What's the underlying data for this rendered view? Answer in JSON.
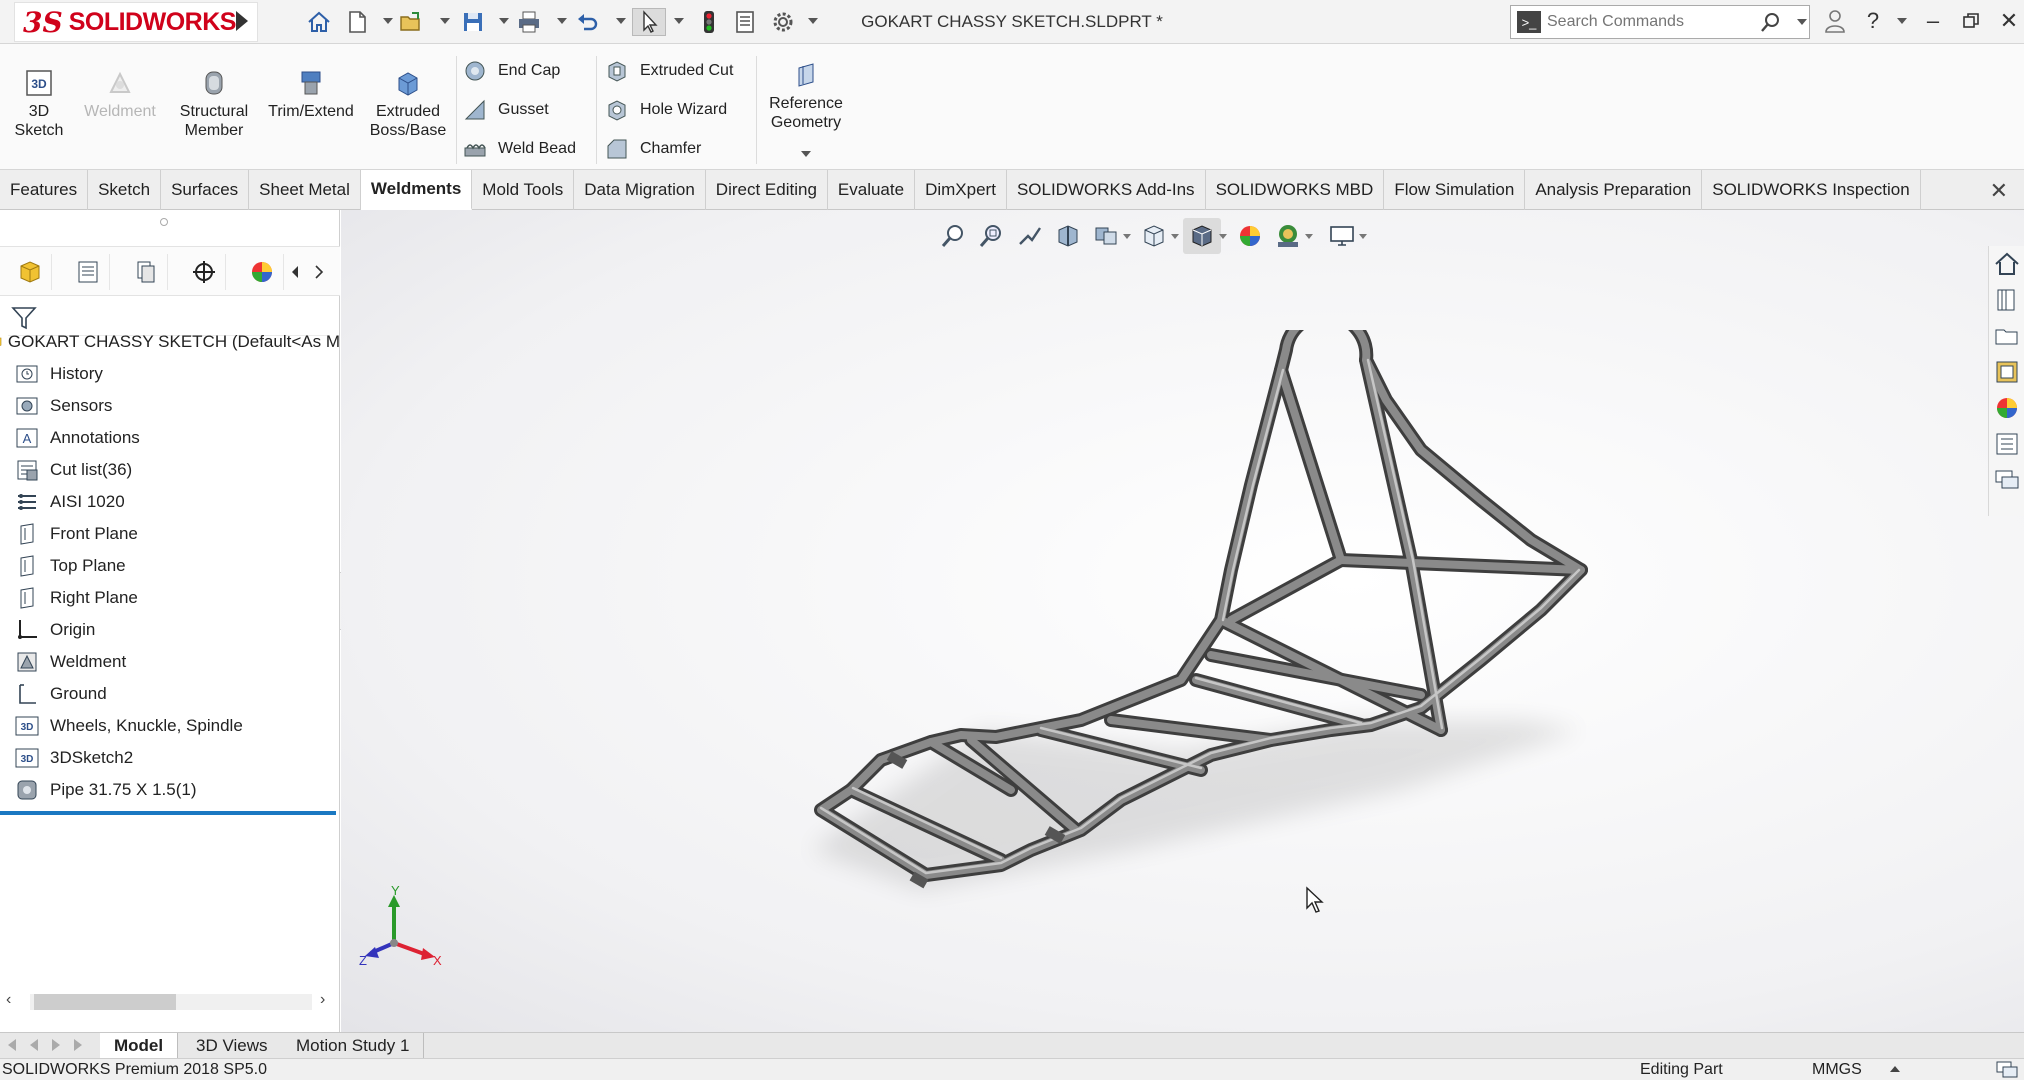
{
  "app": {
    "brand_mark": "3S",
    "brand_name": "SOLIDWORKS",
    "document_title": "GOKART CHASSY SKETCH.SLDPRT *"
  },
  "search": {
    "placeholder": "Search Commands"
  },
  "commands": {
    "sketch3d": "3D\nSketch",
    "weldment": "Weldment",
    "structural_member": "Structural\nMember",
    "trim_extend": "Trim/Extend",
    "extruded_boss": "Extruded\nBoss/Base",
    "end_cap": "End Cap",
    "gusset": "Gusset",
    "weld_bead": "Weld Bead",
    "extruded_cut": "Extruded Cut",
    "hole_wizard": "Hole Wizard",
    "chamfer": "Chamfer",
    "reference_geometry": "Reference\nGeometry"
  },
  "tabs": [
    "Features",
    "Sketch",
    "Surfaces",
    "Sheet Metal",
    "Weldments",
    "Mold Tools",
    "Data Migration",
    "Direct Editing",
    "Evaluate",
    "DimXpert",
    "SOLIDWORKS Add-Ins",
    "SOLIDWORKS MBD",
    "Flow Simulation",
    "Analysis Preparation",
    "SOLIDWORKS Inspection"
  ],
  "active_tab": "Weldments",
  "tree": {
    "root": "GOKART CHASSY SKETCH  (Default<As M",
    "items": [
      {
        "label": "History",
        "icon": "history-icon"
      },
      {
        "label": "Sensors",
        "icon": "sensors-icon"
      },
      {
        "label": "Annotations",
        "icon": "annotations-icon"
      },
      {
        "label": "Cut list(36)",
        "icon": "cut-list-icon"
      },
      {
        "label": "AISI 1020",
        "icon": "material-icon"
      },
      {
        "label": "Front Plane",
        "icon": "plane-icon"
      },
      {
        "label": "Top Plane",
        "icon": "plane-icon"
      },
      {
        "label": "Right Plane",
        "icon": "plane-icon"
      },
      {
        "label": "Origin",
        "icon": "origin-icon"
      },
      {
        "label": "Weldment",
        "icon": "weldment-icon"
      },
      {
        "label": "Ground",
        "icon": "sketch-icon"
      },
      {
        "label": "Wheels, Knuckle, Spindle",
        "icon": "3d-sketch-icon"
      },
      {
        "label": "3DSketch2",
        "icon": "3d-sketch-icon"
      },
      {
        "label": "Pipe 31.75 X 1.5(1)",
        "icon": "structural-member-icon"
      }
    ]
  },
  "triad": {
    "x": "X",
    "y": "Y",
    "z": "Z"
  },
  "bottom_tabs": [
    "Model",
    "3D Views",
    "Motion Study 1"
  ],
  "active_bottom_tab": "Model",
  "status": {
    "product": "SOLIDWORKS Premium 2018 SP5.0",
    "mode": "Editing Part",
    "units": "MMGS"
  },
  "colors": {
    "brand_red": "#d0021b",
    "tree_selection_bar": "#1a78c2",
    "tube": "#6e6e6e"
  }
}
